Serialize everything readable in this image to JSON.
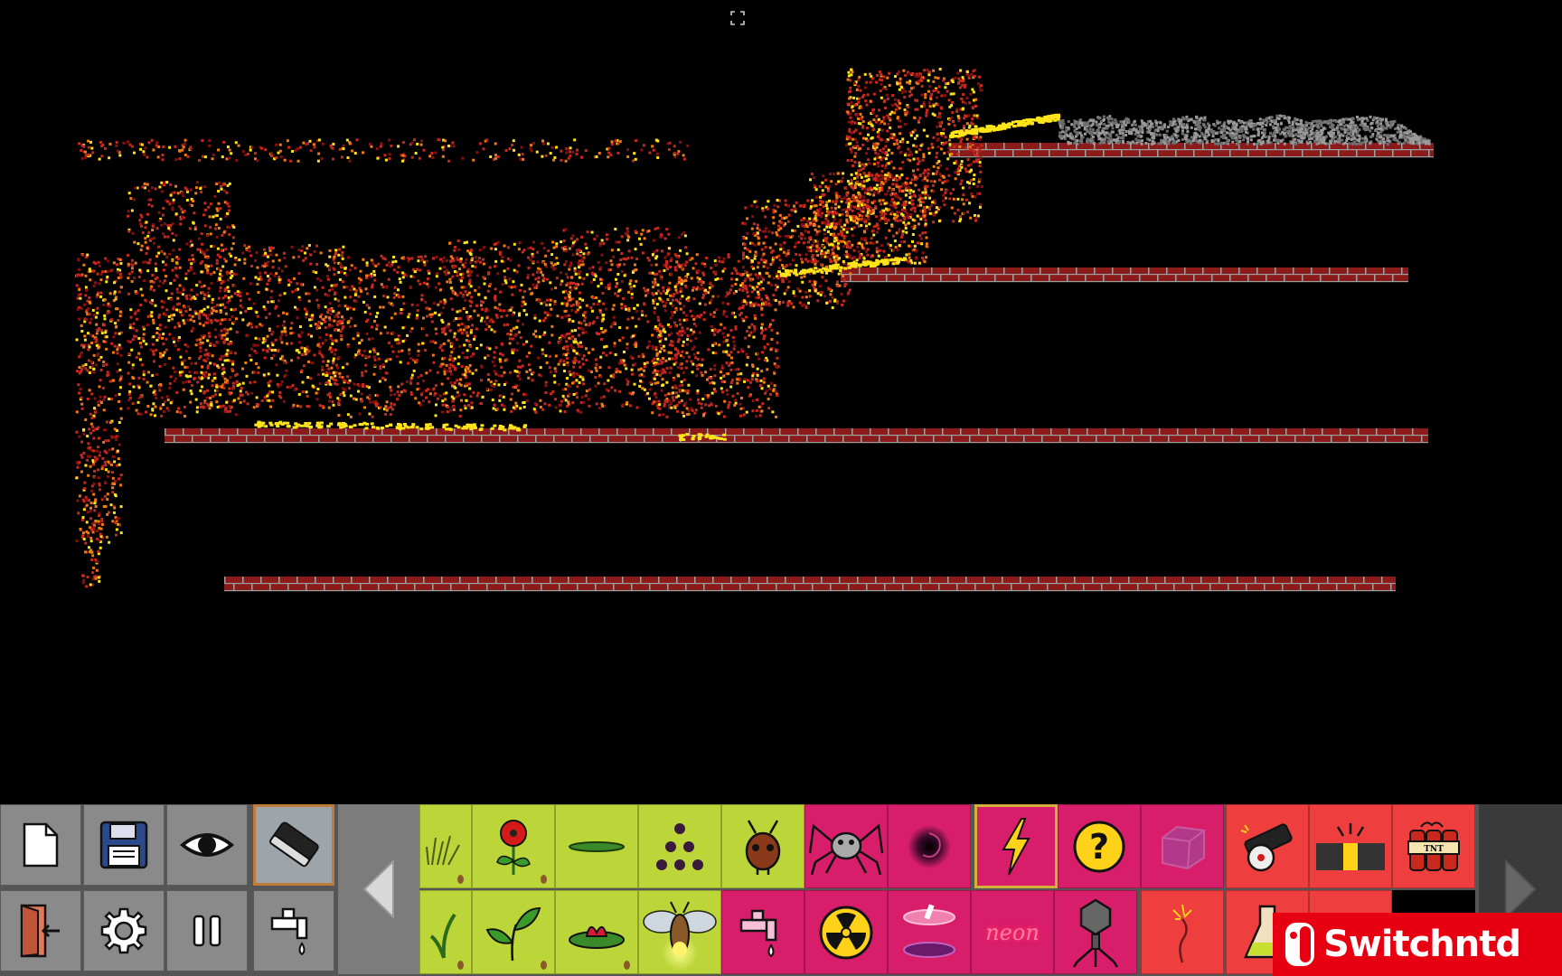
{
  "toolbar": {
    "tools_row1": [
      "new-file-icon",
      "save-disk-icon",
      "eye-icon",
      "eraser-icon"
    ],
    "tools_row2": [
      "exit-door-icon",
      "gear-icon",
      "pause-icon",
      "faucet-icon"
    ],
    "selected_tool": "eraser-icon",
    "nav_left": "chevron-left-icon",
    "nav_right": "chevron-right-icon"
  },
  "elements": {
    "row1": [
      "grass-seed",
      "flower",
      "algae",
      "spore",
      "ant",
      "spider",
      "black-hole",
      "lightning",
      "mystery",
      "glass-cube",
      "cannon",
      "flash-bomb",
      "tnt"
    ],
    "row2": [
      "grass-sprout",
      "plant",
      "lily-pad",
      "firefly",
      "liquid-faucet",
      "radiation",
      "portal",
      "neon",
      "virus-bot",
      "fuse",
      "acid-flask",
      "rocket",
      "empty"
    ],
    "selected": "lightning",
    "neon_label": "neon",
    "mystery_label": "?",
    "tnt_label": "TNT"
  },
  "colors": {
    "plant": "#bcd63a",
    "creature": "#d81e6a",
    "explosive": "#ee3e3e",
    "brick": "#8b1a1a",
    "fire_red": "#c8281e",
    "fire_orange": "#f07a14",
    "fire_yellow": "#ffe41a",
    "ash": "#8c8c8c"
  },
  "watermark": {
    "text": "Switchntd"
  }
}
